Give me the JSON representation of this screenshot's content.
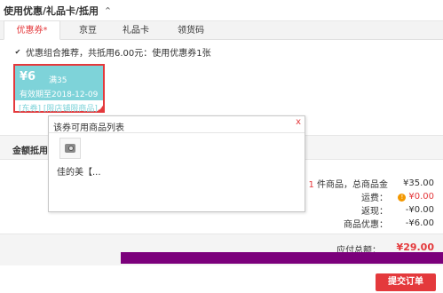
{
  "section": {
    "title": "使用优惠/礼品卡/抵用",
    "toggle_icon": "chevron-up-icon"
  },
  "tabs": [
    {
      "label": "优惠券*",
      "active": true
    },
    {
      "label": "京豆",
      "active": false
    },
    {
      "label": "礼品卡",
      "active": false
    },
    {
      "label": "领货码",
      "active": false
    }
  ],
  "combo": {
    "checked": true,
    "text": "优惠组合推荐，共抵用6.00元：使用优惠券1张"
  },
  "coupon": {
    "amount": "¥6",
    "condition": "满35",
    "valid": "有效期至2018-12-09",
    "tags": "[东券] [限店铺限商品]",
    "color": "#7ed3d9",
    "selected_border": "#e4393c"
  },
  "jine": {
    "label": "金额抵用"
  },
  "popup": {
    "title": "该券可用商品列表",
    "close": "x",
    "product_name": "佳的美【..."
  },
  "summary": {
    "items_prefix": "1",
    "items_label": " 件商品，总商品金",
    "items_value": "¥35.00",
    "shipping_label": "运费：",
    "shipping_value": "¥0.00",
    "cashback_label": "返现：",
    "cashback_value": "-¥0.00",
    "discount_label": "商品优惠：",
    "discount_value": "-¥6.00"
  },
  "total": {
    "label": "应付总额：",
    "value": "¥29.00"
  },
  "submit": {
    "label": "提交订单"
  },
  "colors": {
    "accent": "#e4393c",
    "band": "#7b007b"
  }
}
